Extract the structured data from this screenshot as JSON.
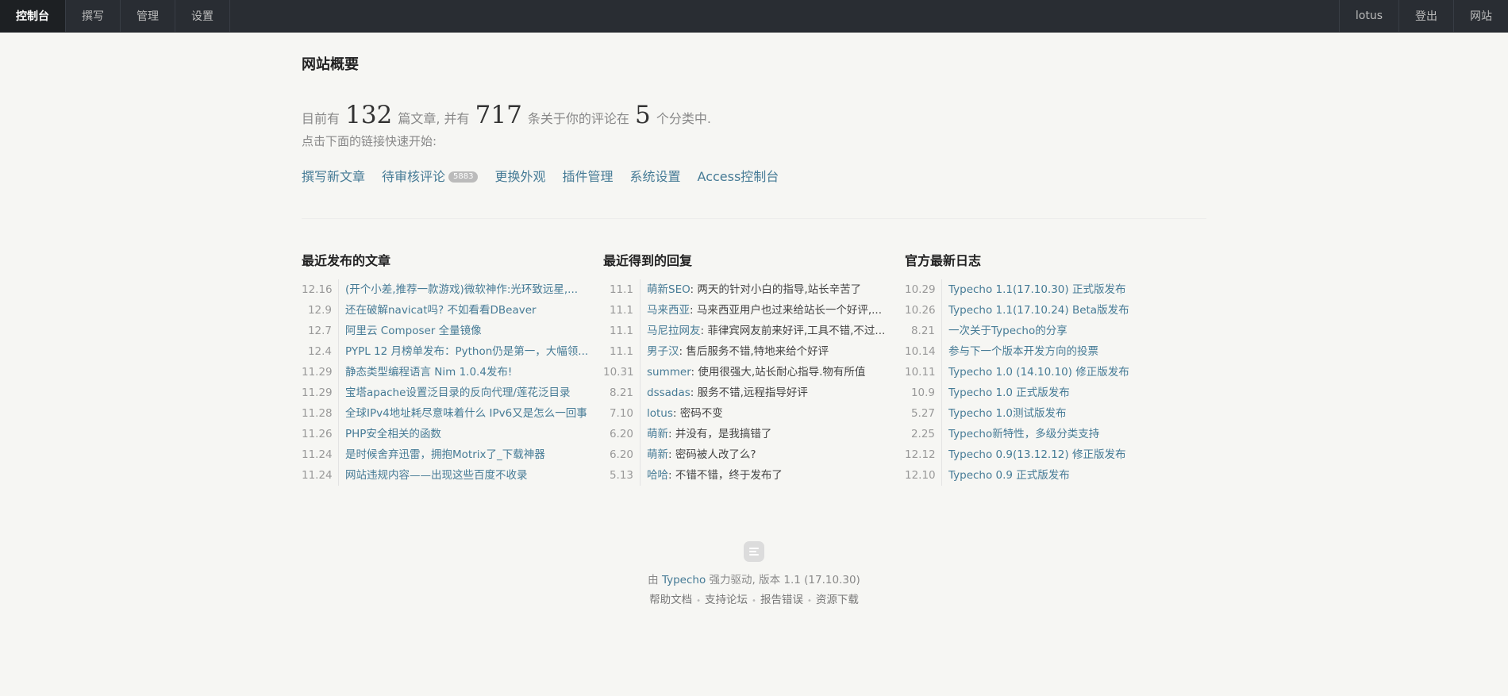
{
  "nav": {
    "left": [
      "控制台",
      "撰写",
      "管理",
      "设置"
    ],
    "right": [
      "lotus",
      "登出",
      "网站"
    ]
  },
  "page_title": "网站概要",
  "summary": {
    "prefix": "目前有",
    "posts": "132",
    "mid1": "篇文章, 并有",
    "comments": "717",
    "mid2": "条关于你的评论在",
    "categories": "5",
    "suffix": "个分类中."
  },
  "hint": "点击下面的链接快速开始:",
  "quick_links": {
    "write": "撰写新文章",
    "pending": "待审核评论",
    "pending_count": "5883",
    "themes": "更换外观",
    "plugins": "插件管理",
    "settings": "系统设置",
    "access": "Access控制台"
  },
  "recent_posts": {
    "title": "最近发布的文章",
    "items": [
      {
        "date": "12.16",
        "title": "(开个小差,推荐一款游戏)微软神作:光环致远星,..."
      },
      {
        "date": "12.9",
        "title": "还在破解navicat吗? 不如看看DBeaver"
      },
      {
        "date": "12.7",
        "title": "阿里云 Composer 全量镜像"
      },
      {
        "date": "12.4",
        "title": "PYPL 12 月榜单发布：Python仍是第一，大幅领..."
      },
      {
        "date": "11.29",
        "title": "静态类型编程语言 Nim 1.0.4发布!"
      },
      {
        "date": "11.29",
        "title": "宝塔apache设置泛目录的反向代理/莲花泛目录"
      },
      {
        "date": "11.28",
        "title": "全球IPv4地址耗尽意味着什么 IPv6又是怎么一回事"
      },
      {
        "date": "11.26",
        "title": "PHP安全相关的函数"
      },
      {
        "date": "11.24",
        "title": "是时候舍弃迅雷，拥抱Motrix了_下载神器"
      },
      {
        "date": "11.24",
        "title": "网站违规内容——出现这些百度不收录"
      }
    ]
  },
  "recent_replies": {
    "title": "最近得到的回复",
    "items": [
      {
        "date": "11.1",
        "author": "萌新SEO",
        "text": ": 两天的针对小白的指导,站长辛苦了"
      },
      {
        "date": "11.1",
        "author": "马来西亚",
        "text": ": 马来西亚用户也过来给站长一个好评,..."
      },
      {
        "date": "11.1",
        "author": "马尼拉网友",
        "text": ": 菲律宾网友前来好评,工具不错,不过..."
      },
      {
        "date": "11.1",
        "author": "男子汉",
        "text": ": 售后服务不错,特地来给个好评"
      },
      {
        "date": "10.31",
        "author": "summer",
        "text": ": 使用很强大,站长耐心指导.物有所值"
      },
      {
        "date": "8.21",
        "author": "dssadas",
        "text": ": 服务不错,远程指导好评"
      },
      {
        "date": "7.10",
        "author": "lotus",
        "text": ": 密码不变"
      },
      {
        "date": "6.20",
        "author": "萌新",
        "text": ": 并没有，是我搞错了"
      },
      {
        "date": "6.20",
        "author": "萌新",
        "text": ": 密码被人改了么?"
      },
      {
        "date": "5.13",
        "author": "哈哈",
        "text": ": 不错不错，终于发布了"
      }
    ]
  },
  "official_logs": {
    "title": "官方最新日志",
    "items": [
      {
        "date": "10.29",
        "title": "Typecho 1.1(17.10.30) 正式版发布"
      },
      {
        "date": "10.26",
        "title": "Typecho 1.1(17.10.24) Beta版发布"
      },
      {
        "date": "8.21",
        "title": "一次关于Typecho的分享"
      },
      {
        "date": "10.14",
        "title": "参与下一个版本开发方向的投票"
      },
      {
        "date": "10.11",
        "title": "Typecho 1.0 (14.10.10) 修正版发布"
      },
      {
        "date": "10.9",
        "title": "Typecho 1.0 正式版发布"
      },
      {
        "date": "5.27",
        "title": "Typecho 1.0测试版发布"
      },
      {
        "date": "2.25",
        "title": "Typecho新特性，多级分类支持"
      },
      {
        "date": "12.12",
        "title": "Typecho 0.9(13.12.12) 修正版发布"
      },
      {
        "date": "12.10",
        "title": "Typecho 0.9 正式版发布"
      }
    ]
  },
  "footer": {
    "by": "由",
    "brand": "Typecho",
    "powered": "强力驱动, 版本 1.1 (17.10.30)",
    "links": [
      "帮助文档",
      "支持论坛",
      "报告错误",
      "资源下载"
    ],
    "separator": "•"
  }
}
